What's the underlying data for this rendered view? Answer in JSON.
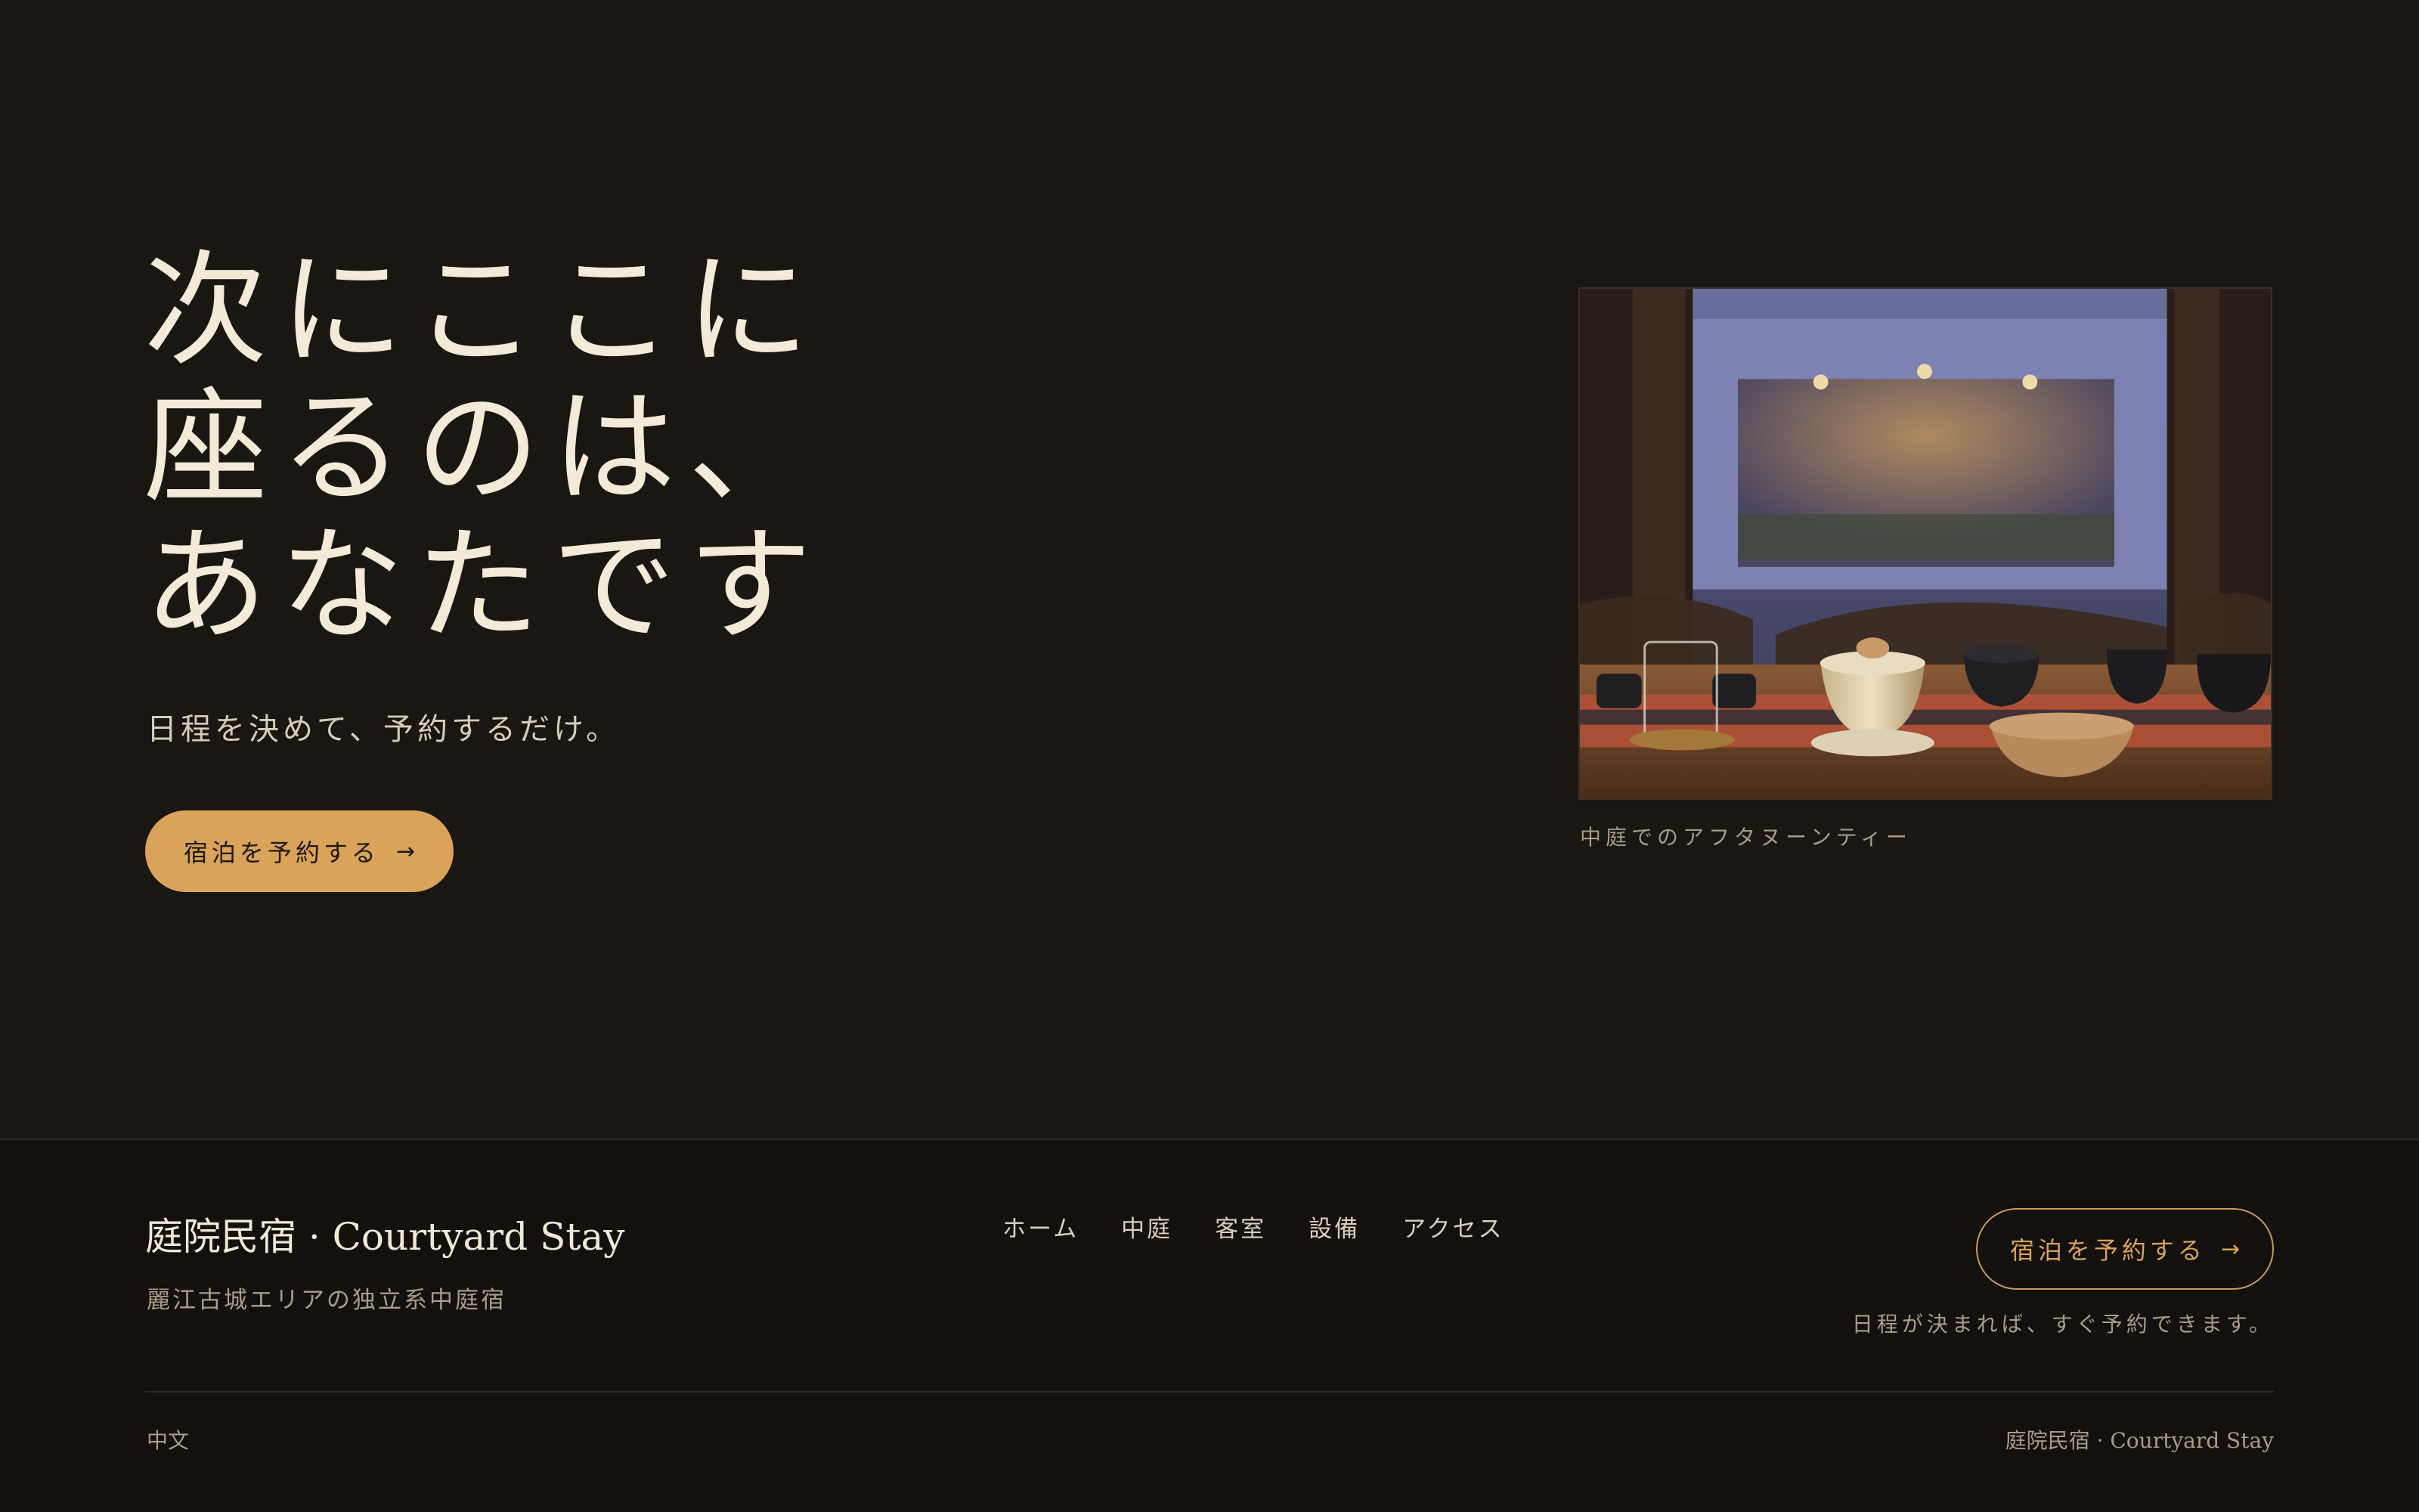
{
  "hero": {
    "headline_lines": [
      "次にここに",
      "座るのは、",
      "あなたです"
    ],
    "subtitle": "日程を決めて、予約するだけ。",
    "cta_label": "宿泊を予約する",
    "cta_arrow": "→",
    "photo_caption": "中庭でのアフタヌーンティー"
  },
  "footer": {
    "brand": "庭院民宿 · Courtyard Stay",
    "tagline": "麗江古城エリアの独立系中庭宿",
    "nav": [
      "ホーム",
      "中庭",
      "客室",
      "設備",
      "アクセス"
    ],
    "cta_label": "宿泊を予約する",
    "cta_arrow": "→",
    "cta_note": "日程が決まれば、すぐ予約できます。",
    "language": "中文",
    "copyright": "庭院民宿 · Courtyard Stay"
  },
  "colors": {
    "background": "#1a1612",
    "footer_background": "#13100d",
    "accent": "#d9a35a",
    "text_primary": "#f3ead7",
    "text_muted": "#a99d8a"
  },
  "icons": {
    "cta_arrow": "arrow-right-icon"
  }
}
